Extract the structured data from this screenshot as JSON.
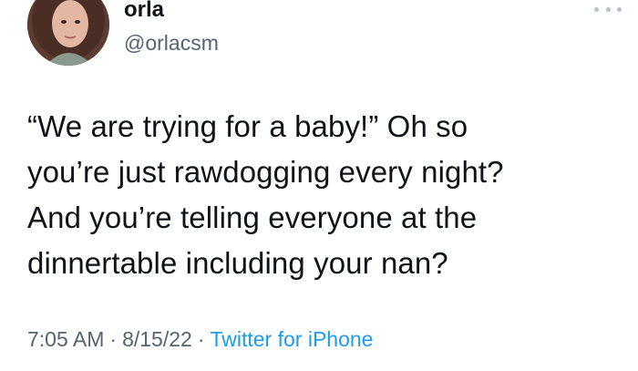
{
  "user": {
    "display_name": "orla",
    "handle": "@orlacsm"
  },
  "tweet": {
    "text": "“We are trying for a baby!” Oh so\nyou’re just rawdogging every night?\nAnd you’re telling everyone at the\ndinnertable including your nan?",
    "time": "7:05 AM",
    "date": "8/15/22",
    "separator": "·",
    "source": "Twitter for iPhone"
  },
  "icons": {
    "avatar": "avatar-photo",
    "more": "more-horizontal-icon"
  },
  "colors": {
    "text": "#0f1419",
    "secondary": "#536471",
    "link": "#1d9bf0",
    "background": "#ffffff"
  }
}
